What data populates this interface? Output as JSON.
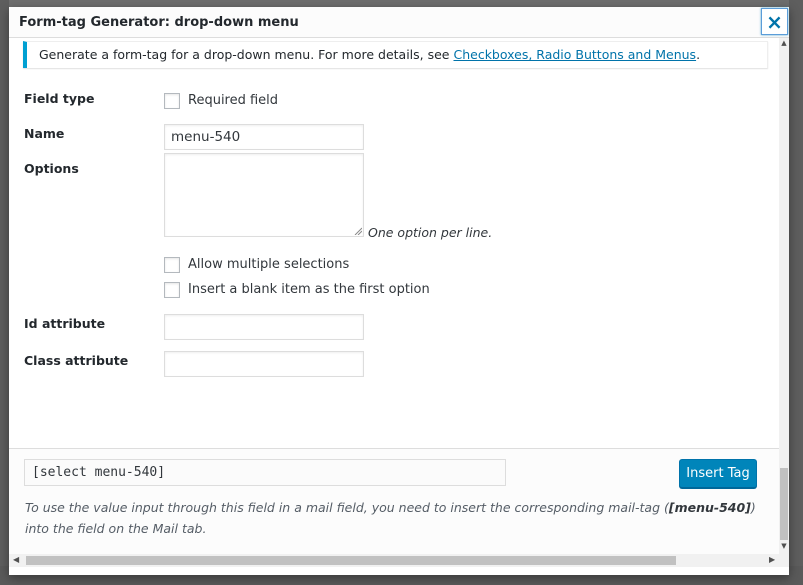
{
  "dialog": {
    "title": "Form-tag Generator: drop-down menu",
    "close_icon": "×"
  },
  "notice": {
    "text": "Generate a form-tag for a drop-down menu. For more details, see ",
    "link": "Checkboxes, Radio Buttons and Menus",
    "suffix": "."
  },
  "fields": {
    "field_type_label": "Field type",
    "required_label": "Required field",
    "name_label": "Name",
    "name_value": "menu-540",
    "options_label": "Options",
    "options_value": "",
    "options_hint": "One option per line.",
    "multiple_label": "Allow multiple selections",
    "blank_label": "Insert a blank item as the first option",
    "id_label": "Id attribute",
    "id_value": "",
    "class_label": "Class attribute",
    "class_value": ""
  },
  "footer": {
    "tag_value": "[select menu-540]",
    "insert_label": "Insert Tag",
    "note_before": "To use the value input through this field in a mail field, you need to insert the corresponding mail-tag (",
    "note_tag": "[menu-540]",
    "note_after": ") into the field on the Mail tab."
  },
  "icons": {
    "close": "close-icon",
    "resize": "resize-grip-icon",
    "scroll_up": "scroll-up-arrow-icon",
    "scroll_down": "scroll-down-arrow-icon",
    "scroll_left": "scroll-left-arrow-icon",
    "scroll_right": "scroll-right-arrow-icon"
  },
  "colors": {
    "accent": "#0085ba",
    "link": "#0073aa",
    "notice_border": "#00a0d2"
  }
}
